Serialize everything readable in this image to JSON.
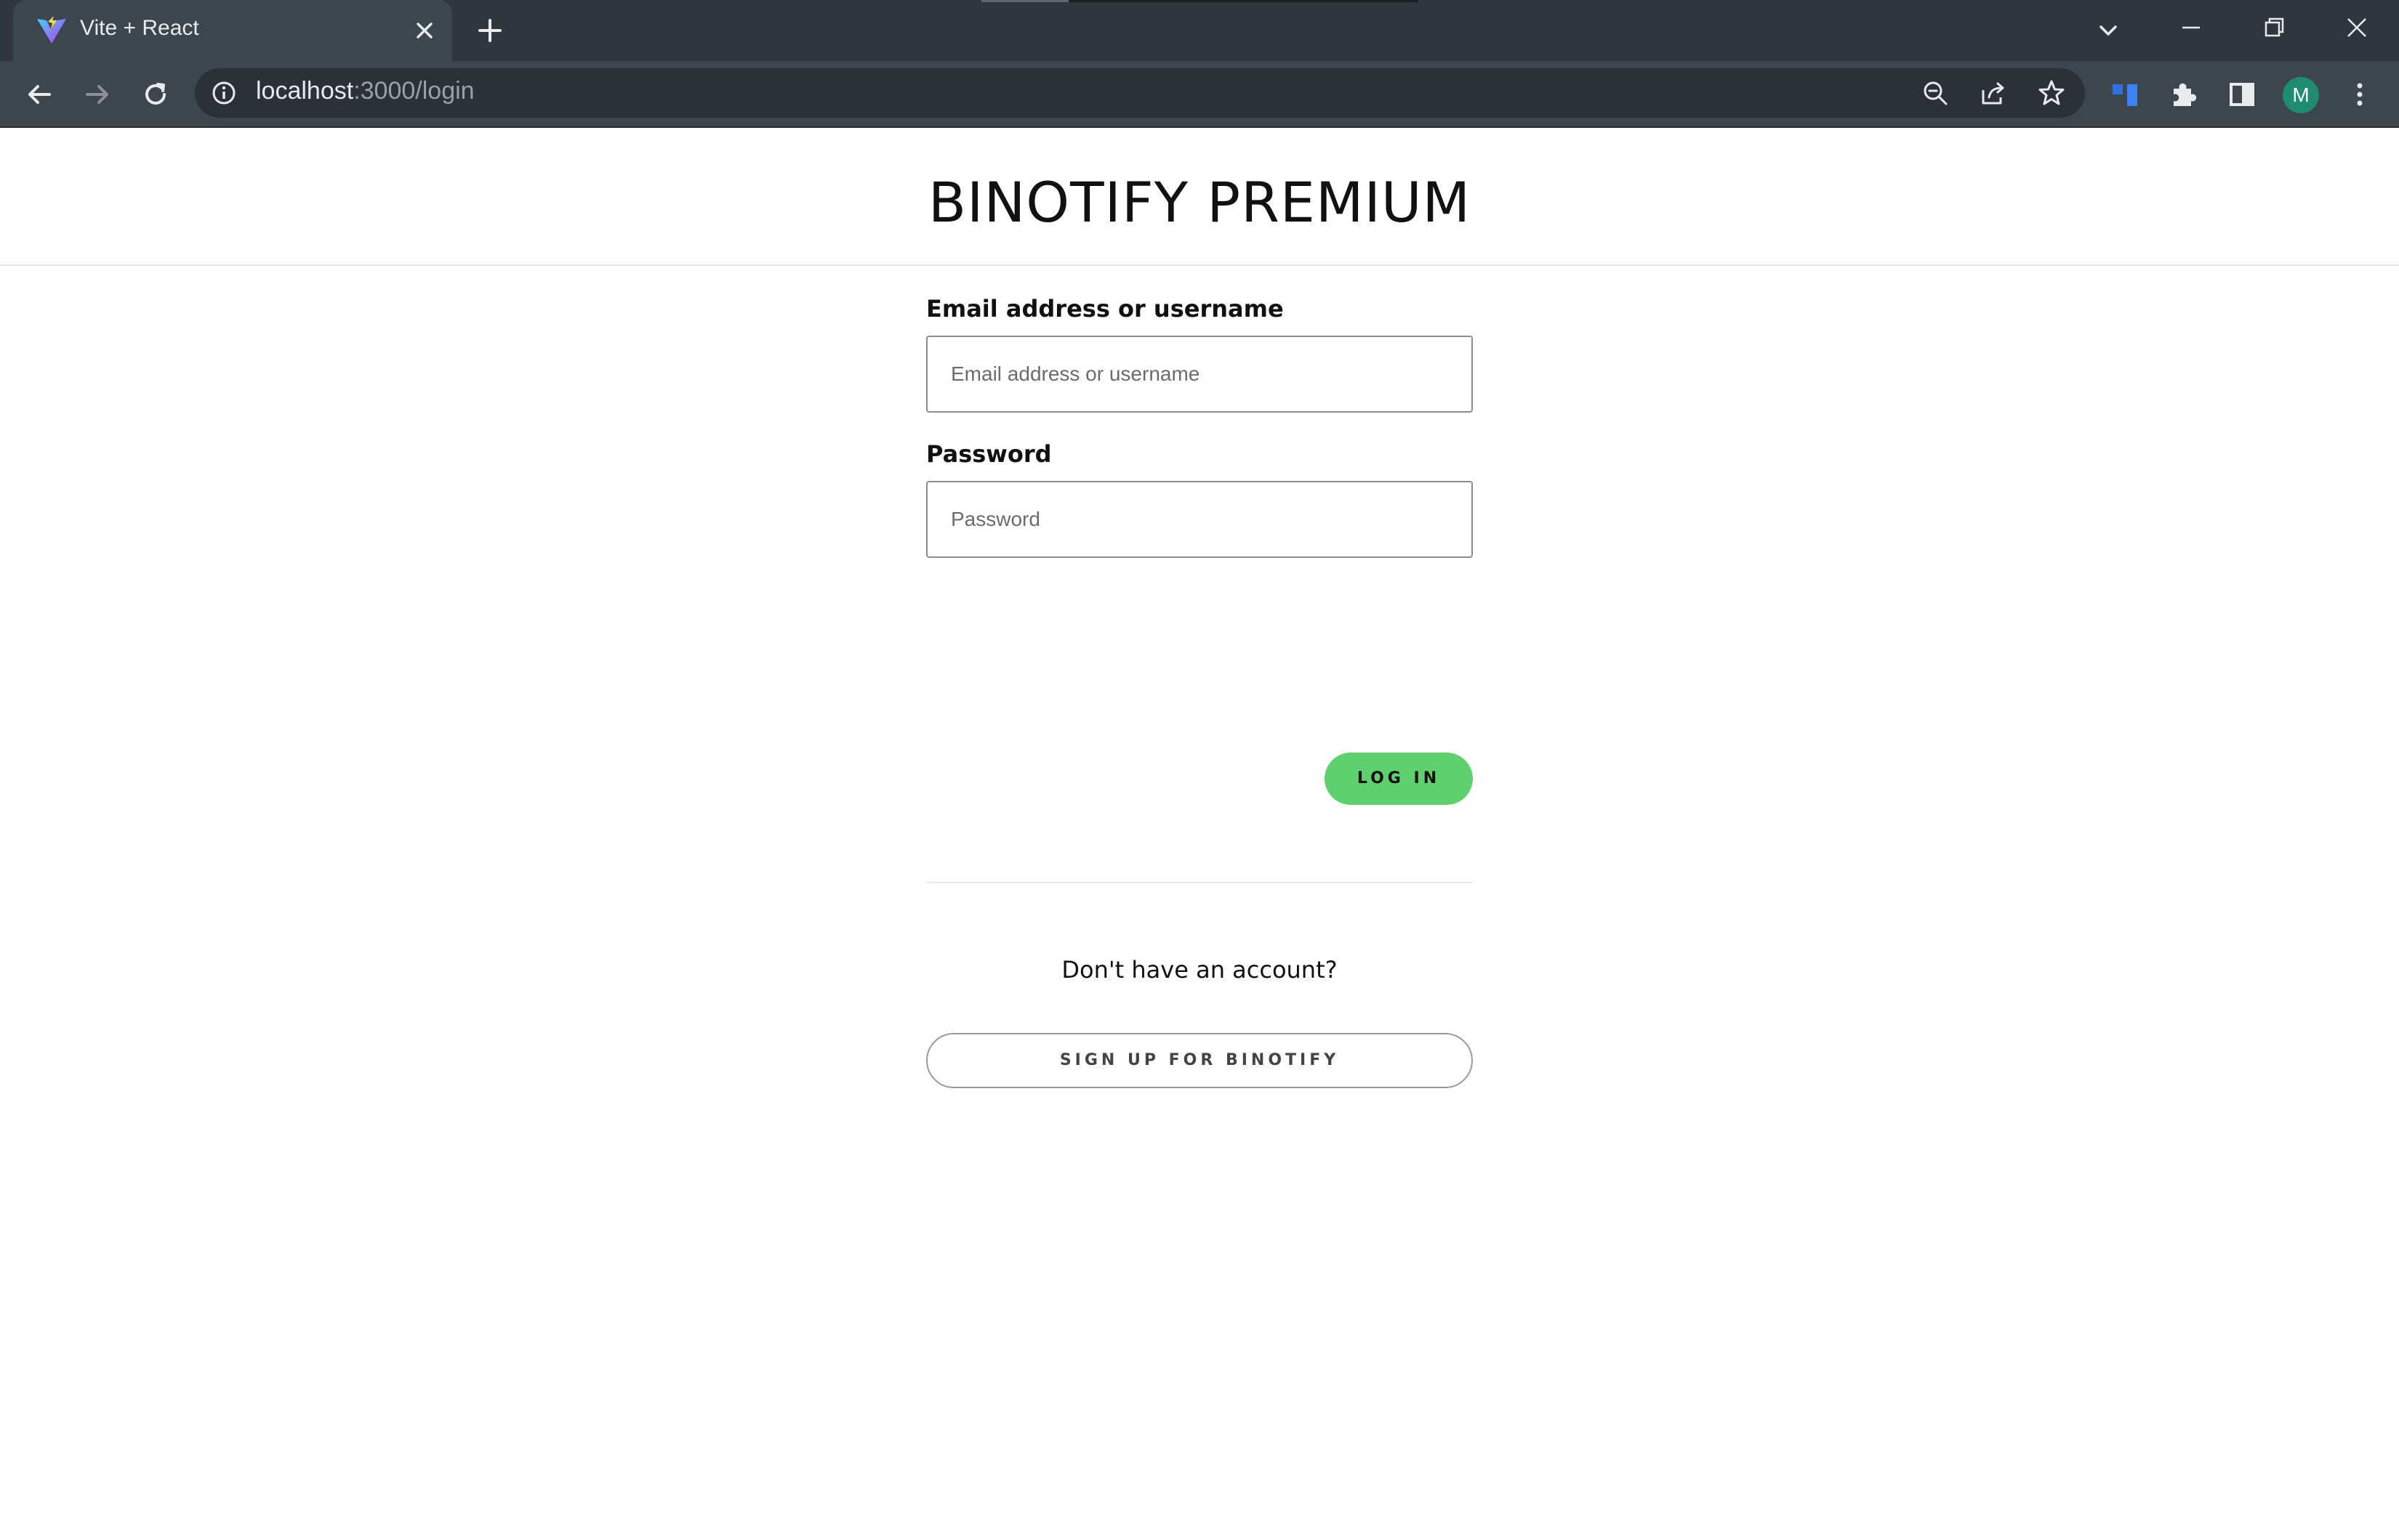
{
  "browser": {
    "tab": {
      "title": "Vite + React"
    },
    "address_bar": {
      "host": "localhost",
      "path": ":3000/login"
    },
    "profile_initial": "M"
  },
  "page": {
    "title": "BINOTIFY PREMIUM",
    "form": {
      "username": {
        "label": "Email address or username",
        "placeholder": "Email address or username",
        "value": ""
      },
      "password": {
        "label": "Password",
        "placeholder": "Password",
        "value": ""
      },
      "login_label": "LOG IN"
    },
    "signup_prompt": "Don't have an account?",
    "signup_label": "SIGN UP FOR BINOTIFY"
  },
  "colors": {
    "accent_green": "#5ed06e",
    "chrome_dark": "#2f363d",
    "chrome_toolbar": "#3d454d",
    "avatar_bg": "#1e8c6e"
  },
  "icons": [
    "vite-logo-icon",
    "close-icon",
    "plus-icon",
    "chevron-down-icon",
    "minimize-icon",
    "restore-icon",
    "window-close-icon",
    "back-arrow-icon",
    "forward-arrow-icon",
    "reload-icon",
    "info-icon",
    "zoom-icon",
    "share-icon",
    "star-icon",
    "extension-tab-icon",
    "puzzle-icon",
    "side-panel-icon",
    "kebab-menu-icon"
  ]
}
